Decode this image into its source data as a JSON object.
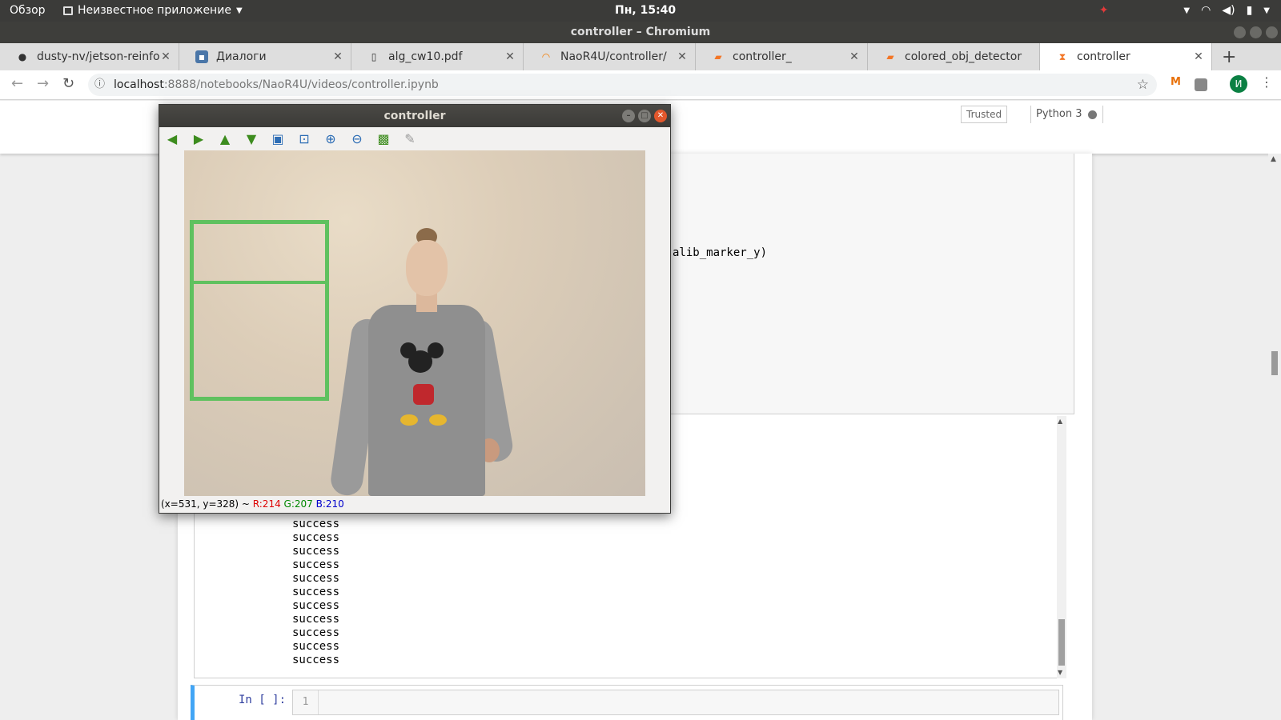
{
  "topbar": {
    "activities": "Обзор",
    "app_menu": "Неизвестное приложение",
    "clock": "Пн, 15:40"
  },
  "window": {
    "title": "controller – Chromium"
  },
  "tabs": [
    {
      "label": "dusty-nv/jetson-reinfo",
      "icon": "github-icon"
    },
    {
      "label": "Диалоги",
      "icon": "vk-icon"
    },
    {
      "label": "alg_cw10.pdf",
      "icon": "document-icon"
    },
    {
      "label": "NaoR4U/controller/",
      "icon": "loading-icon"
    },
    {
      "label": "controller_",
      "icon": "jupyter-notebook-icon"
    },
    {
      "label": "colored_obj_detector",
      "icon": "jupyter-notebook-icon"
    },
    {
      "label": "controller",
      "icon": "hourglass-icon",
      "active": true
    }
  ],
  "address": {
    "host": "localhost",
    "path": ":8888/notebooks/NaoR4U/videos/controller.ipynb"
  },
  "extensions": {
    "m_label": "M",
    "avatar_letter": "И"
  },
  "jupyter": {
    "trusted": "Trusted",
    "kernel": "Python 3",
    "code_fragment": "alib_marker_y)",
    "output_lines": [
      "success",
      "success",
      "success",
      "success",
      "success",
      "success",
      "success",
      "success",
      "success",
      "success",
      "success",
      "success"
    ],
    "new_cell_prompt": "In [ ]:",
    "line_number": "1"
  },
  "cv_window": {
    "title": "controller",
    "status_coords": "(x=531, y=328) ~ ",
    "status_r": "R:214",
    "status_g": "G:207",
    "status_b": "B:210"
  },
  "colors": {
    "roi_green": "#5fc15f",
    "jupyter_selected_cell": "#42a5f5",
    "ubuntu_topbar": "#3b3b39"
  }
}
